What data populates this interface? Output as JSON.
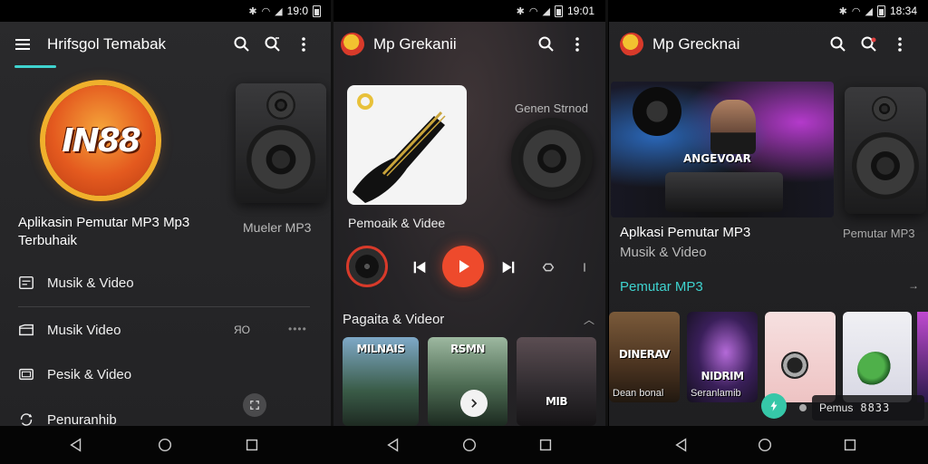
{
  "colors": {
    "accent_teal": "#3fd3cf",
    "play_red": "#ee4a2c",
    "logo_orange": "#e45a1f",
    "background": "#242426"
  },
  "status_bar": [
    {
      "time": "19:0"
    },
    {
      "time": "19:01"
    },
    {
      "time": "18:34"
    }
  ],
  "screen1": {
    "title": "Hrifsgol Temabak",
    "logo_text": "IN88",
    "hero_title": "Aplikasin Pemutar MP3 Mp3 Terbuhaik",
    "side_label": "Mueler MP3",
    "menu": [
      {
        "label": "Musik & Video",
        "icon": "video-file-icon"
      },
      {
        "label": "Musik Video",
        "icon": "folder-icon",
        "trailing": "ЯO"
      },
      {
        "label": "Pesik & Video",
        "icon": "tv-icon"
      },
      {
        "label": "Penuranhib",
        "icon": "sync-icon"
      }
    ]
  },
  "screen2": {
    "title": "Mp Grekanii",
    "side_label": "Genen Strnod",
    "album_label": "Pemoaik & Videe",
    "section_title": "Pagaita & Videor",
    "thumbnails": [
      {
        "caption": "MILNAIS"
      },
      {
        "caption": "RSMN"
      },
      {
        "caption": "MIB"
      }
    ]
  },
  "screen3": {
    "title": "Mp Grecknai",
    "banner_label": "ANGEVOAR",
    "hero_title": "Aplkasi Pemutar MP3",
    "hero_subtitle": "Musik & Video",
    "side_label": "Pemutar MP3",
    "section_title": "Pemutar MP3",
    "thumbnails": [
      {
        "caption": "DINERAV",
        "sub": "Dean bonal"
      },
      {
        "caption": "NIDRIM",
        "sub": "Seranlamib"
      },
      {
        "caption": "",
        "sub": ""
      },
      {
        "caption": "",
        "sub": ""
      }
    ],
    "mini_player": {
      "label": "Pemus",
      "count": "8833"
    }
  },
  "icons": {
    "menu": "hamburger-menu-icon",
    "search": "search-icon",
    "more": "more-vert-icon",
    "back": "back-triangle-icon",
    "home": "home-circle-icon",
    "recents": "recents-square-icon"
  }
}
